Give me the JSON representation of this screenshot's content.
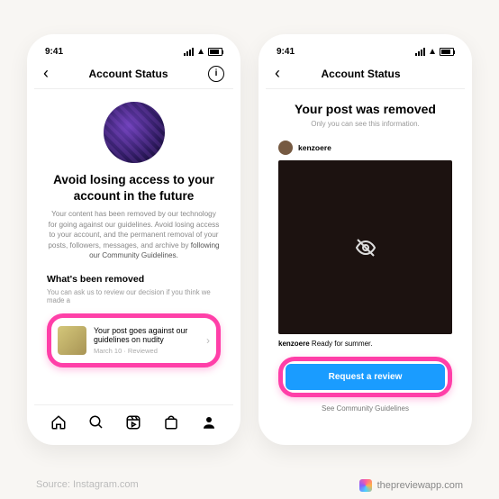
{
  "statusbar": {
    "time": "9:41"
  },
  "phone1": {
    "nav_title": "Account Status",
    "headline_line1": "Avoid losing access to your",
    "headline_line2": "account in the future",
    "body": "Your content has been removed by our technology for going against our guidelines. Avoid losing access to your account, and the permanent removal of your posts, followers, messages, and archive by",
    "body_link": "following our Community Guidelines.",
    "section": "What's been removed",
    "section_sub": "You can ask us to review our decision if you think we made a",
    "row_title": "Your post goes against our guidelines on nudity",
    "row_meta": "March 10 · Reviewed"
  },
  "phone2": {
    "nav_title": "Account Status",
    "title": "Your post was removed",
    "sub": "Only you can see this information.",
    "username": "kenzoere",
    "caption_user": "kenzoere",
    "caption_text": "Ready for summer.",
    "button": "Request a review",
    "guidelines": "See Community Guidelines"
  },
  "footer": {
    "source": "Source: Instagram.com",
    "brand": "thepreviewapp.com"
  }
}
